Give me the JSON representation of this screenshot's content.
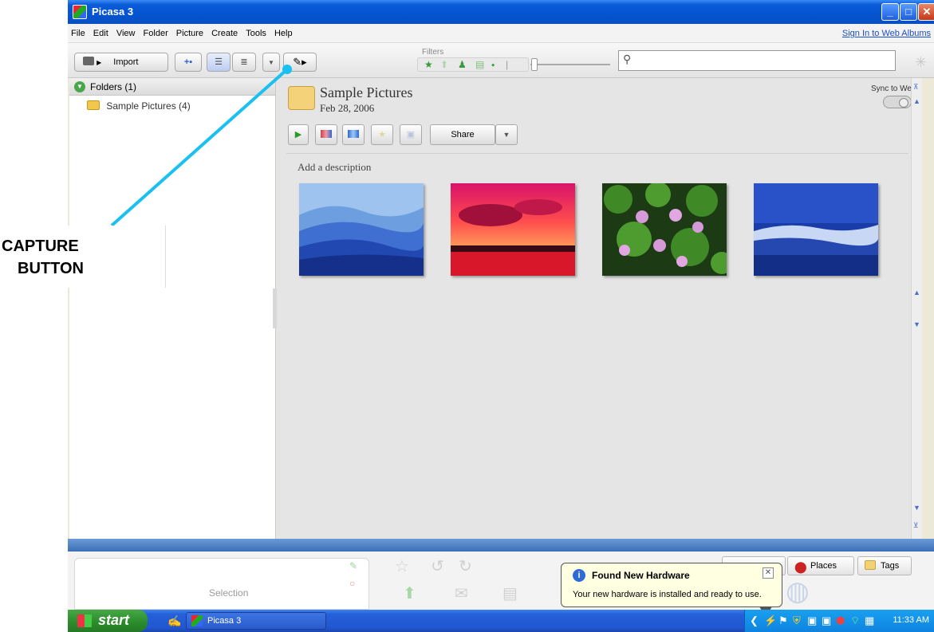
{
  "annotation": {
    "line1": "CAPTURE",
    "line2": "BUTTON"
  },
  "window": {
    "title": "Picasa 3",
    "controls": {
      "minimize": "_",
      "maximize": "□",
      "close": "✕"
    }
  },
  "menu": {
    "items": [
      "File",
      "Edit",
      "View",
      "Folder",
      "Picture",
      "Create",
      "Tools",
      "Help"
    ],
    "signin": "Sign In to Web Albums"
  },
  "toolbar": {
    "import_label": "Import",
    "filters_label": "Filters",
    "search_value": "",
    "search_placeholder": ""
  },
  "left_panel": {
    "header": "Folders (1)",
    "folders": [
      {
        "label": "Sample Pictures (4)"
      }
    ]
  },
  "album": {
    "title": "Sample Pictures",
    "date": "Feb 28, 2006",
    "sync_label": "Sync to Web",
    "share_label": "Share",
    "description_placeholder": "Add a description"
  },
  "thumbnails": [
    {
      "name": "Blue hills"
    },
    {
      "name": "Sunset"
    },
    {
      "name": "Water lilies"
    },
    {
      "name": "Winter"
    }
  ],
  "tray": {
    "selection_label": "Selection",
    "places_label": "Places",
    "tags_label": "Tags"
  },
  "notification": {
    "title": "Found New Hardware",
    "message": "Your new hardware is installed and ready to use."
  },
  "taskbar": {
    "start_label": "start",
    "task_label": "Picasa 3",
    "clock": "11:33 AM"
  },
  "colors": {
    "titlebar": "#0554d2",
    "callout_line": "#19c0f0",
    "notification_bg": "#ffffe1",
    "start_green": "#2b8a2b"
  }
}
